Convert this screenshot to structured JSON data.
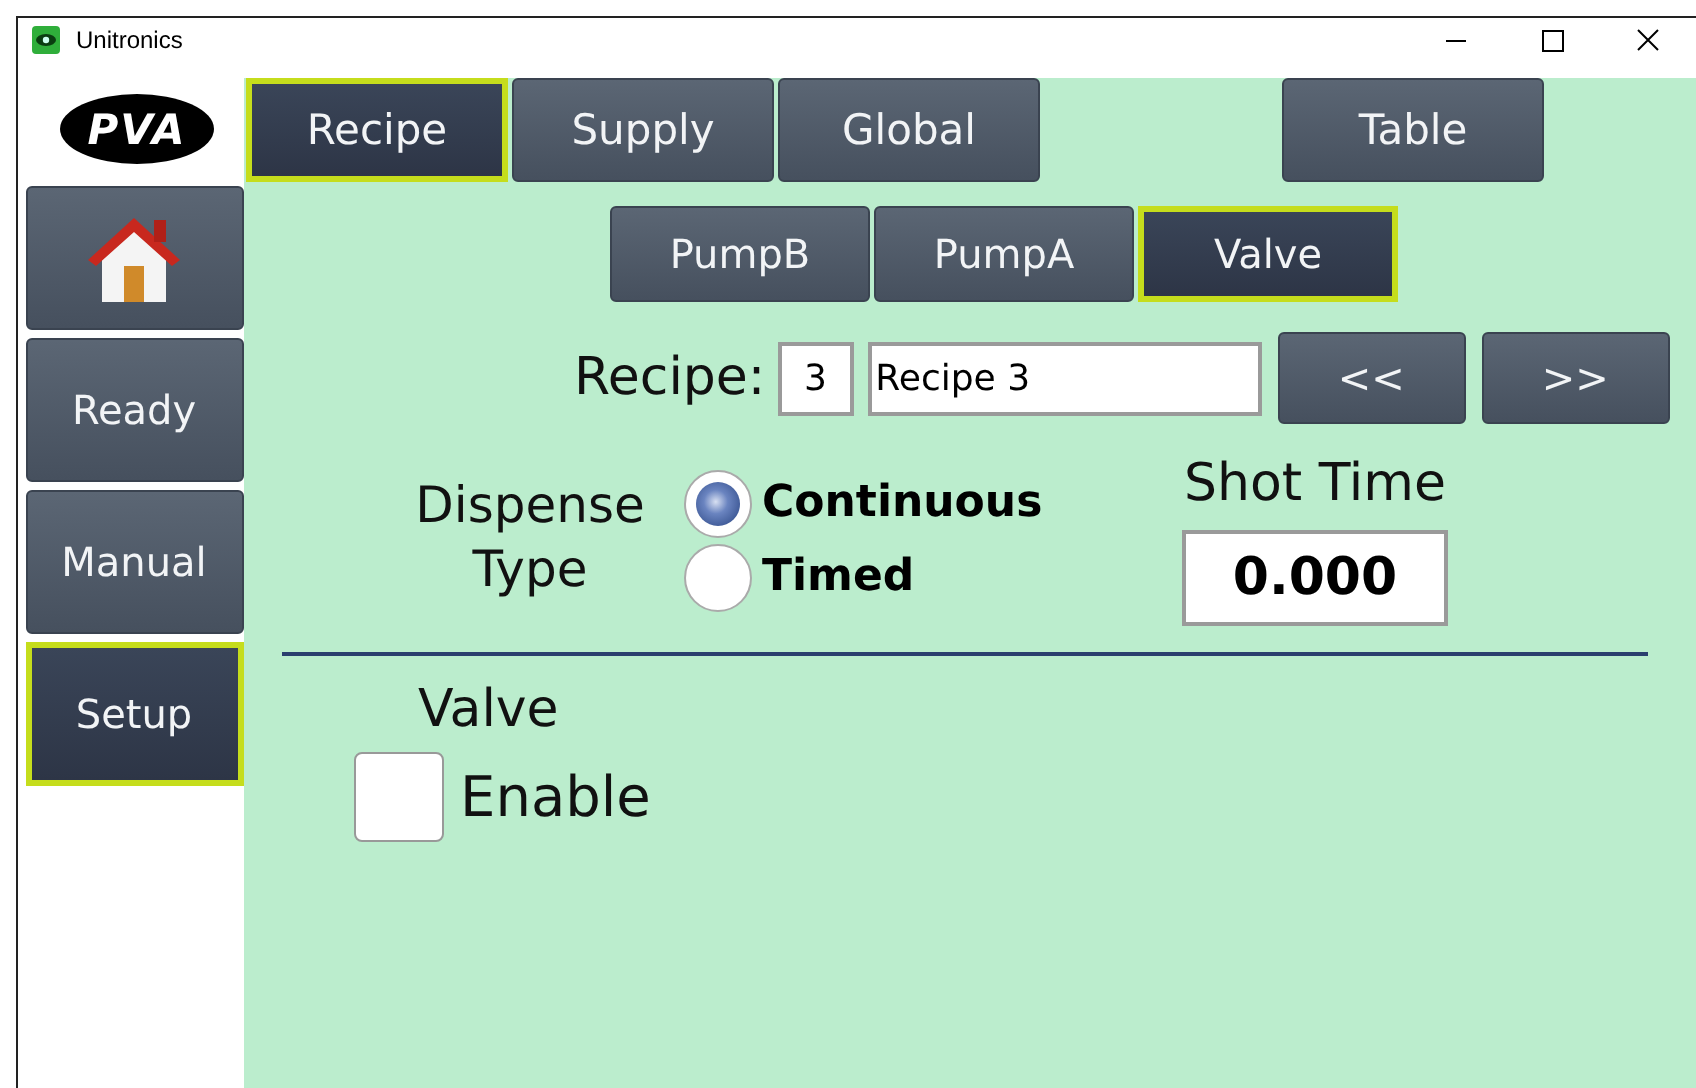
{
  "window": {
    "title": "Unitronics"
  },
  "sidebar": {
    "logo": "PVA",
    "items": [
      {
        "kind": "home",
        "selected": false
      },
      {
        "kind": "text",
        "label": "Ready",
        "selected": false
      },
      {
        "kind": "text",
        "label": "Manual",
        "selected": false
      },
      {
        "kind": "text",
        "label": "Setup",
        "selected": true
      }
    ]
  },
  "tabs": [
    {
      "label": "Recipe",
      "selected": true
    },
    {
      "label": "Supply",
      "selected": false
    },
    {
      "label": "Global",
      "selected": false
    },
    {
      "label": "Table",
      "selected": false
    }
  ],
  "sub_tabs": [
    {
      "label": "PumpB",
      "selected": false
    },
    {
      "label": "PumpA",
      "selected": false
    },
    {
      "label": "Valve",
      "selected": true
    }
  ],
  "recipe": {
    "label": "Recipe:",
    "number": "3",
    "name": "Recipe 3",
    "prev_button": "<<",
    "next_button": ">>"
  },
  "dispense_type": {
    "label": "Dispense Type",
    "options": [
      {
        "label": "Continuous",
        "selected": true
      },
      {
        "label": "Timed",
        "selected": false
      }
    ]
  },
  "shot_time": {
    "label": "Shot Time",
    "value": "0.000"
  },
  "valve": {
    "title": "Valve",
    "enable": {
      "label": "Enable",
      "checked": false
    }
  }
}
